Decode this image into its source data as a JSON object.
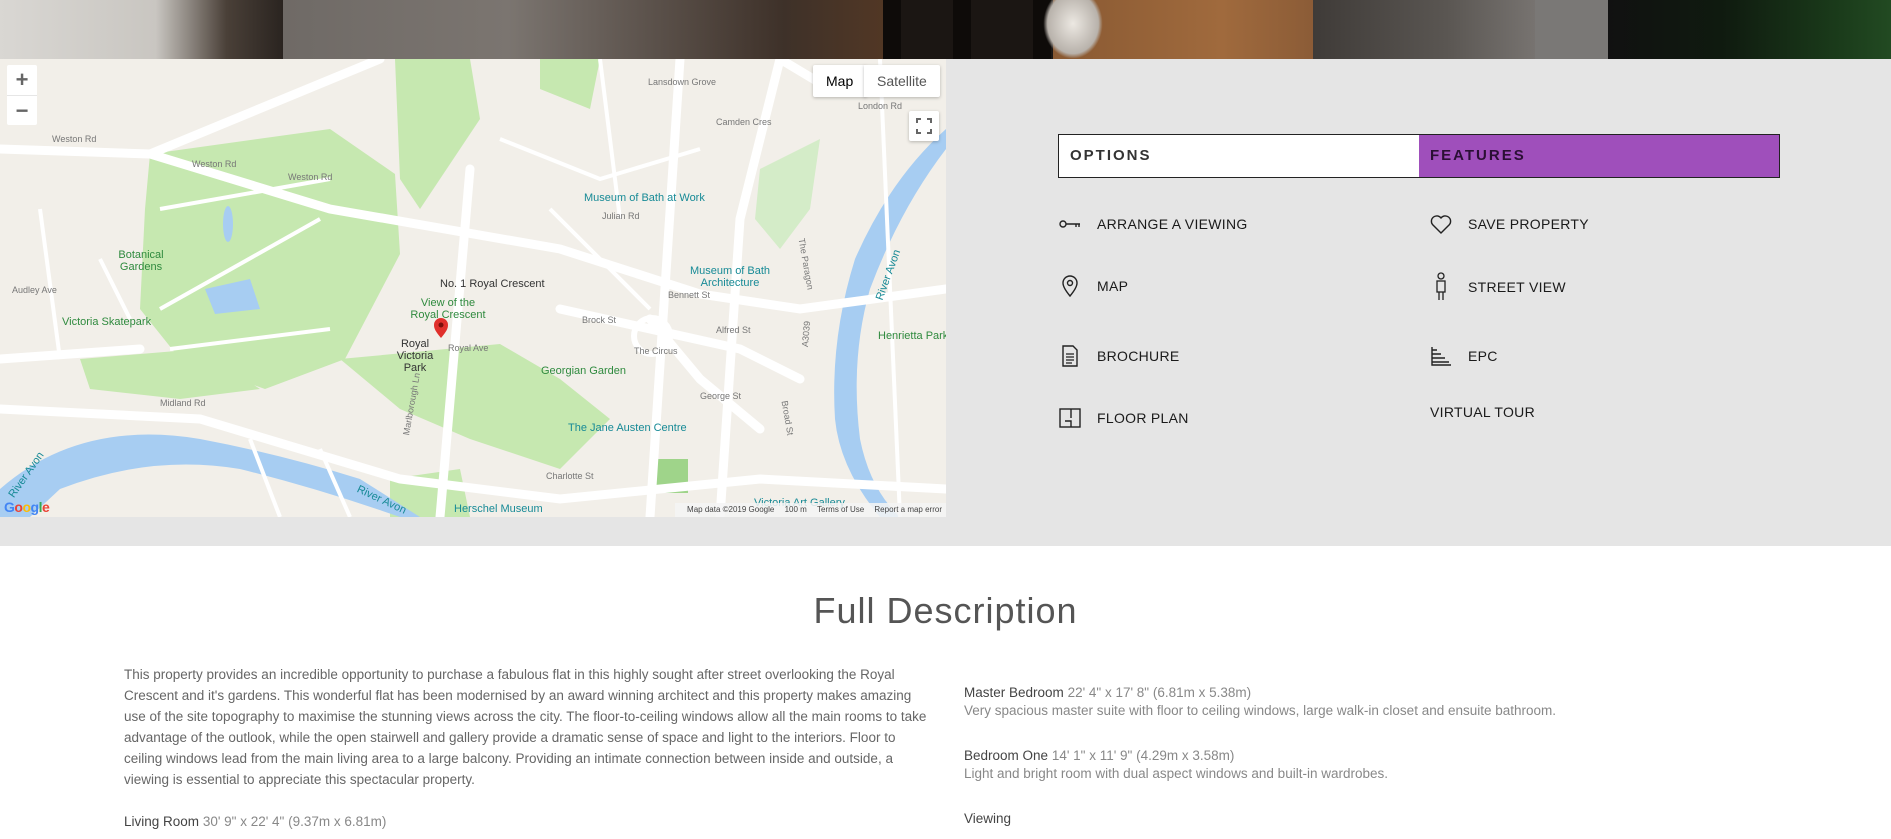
{
  "map": {
    "zoom_in": "+",
    "zoom_out": "−",
    "type_map": "Map",
    "type_satellite": "Satellite",
    "google_logo": "Google",
    "footer": {
      "data": "Map data ©2019 Google",
      "scale": "100 m",
      "terms": "Terms of Use",
      "report": "Report a map error"
    },
    "labels": {
      "weston_rd_1": "Weston Rd",
      "weston_rd_2": "Weston Rd",
      "weston_rd_3": "Weston Rd",
      "lansdown_grove": "Lansdown Grove",
      "london_rd": "London Rd",
      "museum_of_bath_at_work": "Museum of Bath at Work",
      "julian_rd": "Julian Rd",
      "botanical_gardens": "Botanical Gardens",
      "royal_crescent": "No. 1 Royal Crescent",
      "view_of_royal_crescent": "View of the Royal Crescent",
      "museum_of_bath_architecture": "Museum of Bath Architecture",
      "victoria_skatepark": "Victoria Skatepark",
      "royal_victoria_park": "Royal Victoria Park",
      "royal_ave": "Royal Ave",
      "brock_st": "Brock St",
      "the_circus": "The Circus",
      "alfred_st": "Alfred St",
      "bennett_st": "Bennett St",
      "georgian_garden": "Georgian Garden",
      "george_st": "George St",
      "the_jane_austen_centre": "The Jane Austen Centre",
      "charlotte_st": "Charlotte St",
      "herschel_museum": "Herschel Museum",
      "victoria_art_gallery": "Victoria Art Gallery",
      "river_avon_1": "River Avon",
      "river_avon_2": "River Avon",
      "river_avon_3": "River Avon",
      "henrietta_park": "Henrietta Park",
      "the_paragon": "The Paragon",
      "a3039": "A3039",
      "midland_rd": "Midland Rd",
      "audley_ave": "Audley Ave",
      "marlborough_ln": "Marlborough Ln",
      "broad_st": "Broad St",
      "camden_cres": "Camden Cres"
    }
  },
  "tabs": {
    "options": "OPTIONS",
    "features": "FEATURES"
  },
  "features": {
    "arrange_viewing": "ARRANGE A VIEWING",
    "save_property": "SAVE PROPERTY",
    "map": "MAP",
    "street_view": "STREET VIEW",
    "brochure": "BROCHURE",
    "epc": "EPC",
    "floor_plan": "FLOOR PLAN",
    "virtual_tour": "VIRTUAL TOUR"
  },
  "description": {
    "title": "Full Description",
    "intro": "This property provides an incredible opportunity to purchase a fabulous flat in this highly sought after street overlooking the Royal Crescent and it's gardens. This wonderful flat has been modernised by an award winning architect and this property makes amazing use of the site topography to maximise the stunning views across the city. The floor-to-ceiling windows allow all the main rooms to take advantage of the outlook, while the open stairwell and gallery provide a dramatic sense of space and light to the interiors. Floor to ceiling windows lead from the main living area to a large balcony. Providing an intimate connection between inside and outside, a viewing is essential to appreciate this spectacular property.",
    "living_room_name": "Living Room",
    "living_room_dim": "30' 9\" x 22' 4\" (9.37m x 6.81m)",
    "master_bedroom_name": "Master Bedroom",
    "master_bedroom_dim": "22' 4\" x 17' 8\" (6.81m x 5.38m)",
    "master_bedroom_text": "Very spacious master suite with floor to ceiling windows, large walk-in closet and ensuite bathroom.",
    "bedroom_one_name": "Bedroom One",
    "bedroom_one_dim": "14' 1\" x 11' 9\" (4.29m x 3.58m)",
    "bedroom_one_text": "Light and bright room with dual aspect windows and built-in wardrobes.",
    "viewing_name": "Viewing"
  }
}
